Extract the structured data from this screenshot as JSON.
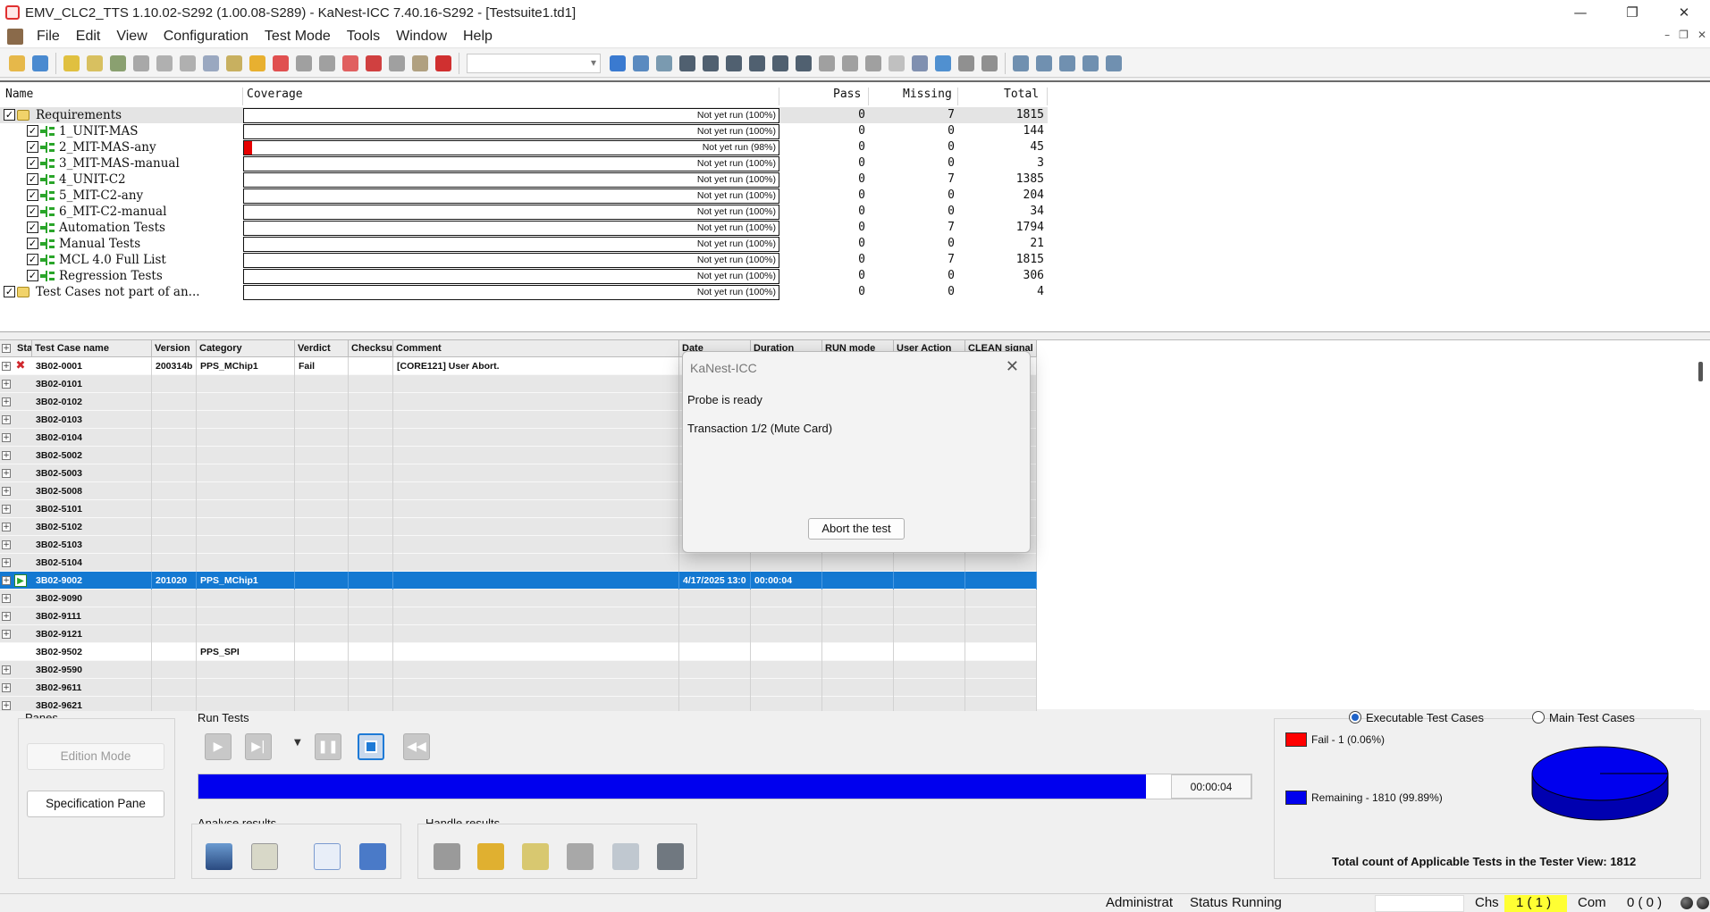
{
  "window": {
    "title": "EMV_CLC2_TTS 1.10.02-S292 (1.00.08-S289)  -  KaNest-ICC 7.40.16-S292  -  [Testsuite1.td1]",
    "minimize": "—",
    "maximize": "❐",
    "close": "✕"
  },
  "menu": {
    "items": [
      "File",
      "Edit",
      "View",
      "Configuration",
      "Test Mode",
      "Tools",
      "Window",
      "Help"
    ],
    "mdi_min": "–",
    "mdi_restore": "❐",
    "mdi_close": "✕"
  },
  "requirements": {
    "headers": {
      "name": "Name",
      "coverage": "Coverage",
      "pass": "Pass",
      "missing": "Missing",
      "total": "Total"
    },
    "rows": [
      {
        "name": "Requirements",
        "level": 0,
        "icon": "folder-icon",
        "coverage": "Not yet run (100%)",
        "fail_frac": 0,
        "pass": "0",
        "missing": "7",
        "total": "1815",
        "selected": true
      },
      {
        "name": "1_UNIT-MAS",
        "level": 1,
        "icon": "requirement-node-icon",
        "coverage": "Not yet run (100%)",
        "fail_frac": 0,
        "pass": "0",
        "missing": "0",
        "total": "144"
      },
      {
        "name": "2_MIT-MAS-any",
        "level": 1,
        "icon": "requirement-node-icon",
        "coverage": "Not yet run (98%)",
        "fail_frac": 0.015,
        "pass": "0",
        "missing": "0",
        "total": "45"
      },
      {
        "name": "3_MIT-MAS-manual",
        "level": 1,
        "icon": "requirement-node-icon",
        "coverage": "Not yet run (100%)",
        "fail_frac": 0,
        "pass": "0",
        "missing": "0",
        "total": "3"
      },
      {
        "name": "4_UNIT-C2",
        "level": 1,
        "icon": "requirement-node-icon",
        "coverage": "Not yet run (100%)",
        "fail_frac": 0,
        "pass": "0",
        "missing": "7",
        "total": "1385"
      },
      {
        "name": "5_MIT-C2-any",
        "level": 1,
        "icon": "requirement-node-icon",
        "coverage": "Not yet run (100%)",
        "fail_frac": 0,
        "pass": "0",
        "missing": "0",
        "total": "204"
      },
      {
        "name": "6_MIT-C2-manual",
        "level": 1,
        "icon": "requirement-node-icon",
        "coverage": "Not yet run (100%)",
        "fail_frac": 0,
        "pass": "0",
        "missing": "0",
        "total": "34"
      },
      {
        "name": "Automation Tests",
        "level": 1,
        "icon": "requirement-node-icon",
        "coverage": "Not yet run (100%)",
        "fail_frac": 0,
        "pass": "0",
        "missing": "7",
        "total": "1794"
      },
      {
        "name": "Manual Tests",
        "level": 1,
        "icon": "requirement-node-icon",
        "coverage": "Not yet run (100%)",
        "fail_frac": 0,
        "pass": "0",
        "missing": "0",
        "total": "21"
      },
      {
        "name": "MCL 4.0 Full List",
        "level": 1,
        "icon": "requirement-node-icon",
        "coverage": "Not yet run (100%)",
        "fail_frac": 0,
        "pass": "0",
        "missing": "7",
        "total": "1815"
      },
      {
        "name": "Regression Tests",
        "level": 1,
        "icon": "requirement-node-icon",
        "coverage": "Not yet run (100%)",
        "fail_frac": 0,
        "pass": "0",
        "missing": "0",
        "total": "306"
      },
      {
        "name": "Test Cases not part of an...",
        "level": 0,
        "icon": "folder-icon",
        "coverage": "Not yet run (100%)",
        "fail_frac": 0,
        "pass": "0",
        "missing": "0",
        "total": "4"
      }
    ]
  },
  "grid": {
    "headers": [
      "Sta",
      "Test Case name",
      "Version",
      "Category",
      "Verdict",
      "Checksu",
      "Comment",
      "Date",
      "Duration",
      "RUN mode",
      "User Action",
      "CLEAN signal"
    ],
    "rows": [
      {
        "status": "fail",
        "name": "3B02-0001",
        "version": "200314b",
        "category": "PPS_MChip1",
        "verdict": "Fail",
        "checksum": "",
        "comment": "[CORE121] User Abort.",
        "date": "",
        "duration": "",
        "style": "white"
      },
      {
        "status": "",
        "name": "3B02-0101",
        "version": "",
        "category": "",
        "verdict": "",
        "checksum": "",
        "comment": "",
        "date": "",
        "duration": "",
        "style": "gray"
      },
      {
        "status": "",
        "name": "3B02-0102",
        "version": "",
        "category": "",
        "verdict": "",
        "checksum": "",
        "comment": "",
        "date": "",
        "duration": "",
        "style": "gray"
      },
      {
        "status": "",
        "name": "3B02-0103",
        "version": "",
        "category": "",
        "verdict": "",
        "checksum": "",
        "comment": "",
        "date": "",
        "duration": "",
        "style": "gray"
      },
      {
        "status": "",
        "name": "3B02-0104",
        "version": "",
        "category": "",
        "verdict": "",
        "checksum": "",
        "comment": "",
        "date": "",
        "duration": "",
        "style": "gray"
      },
      {
        "status": "",
        "name": "3B02-5002",
        "version": "",
        "category": "",
        "verdict": "",
        "checksum": "",
        "comment": "",
        "date": "",
        "duration": "",
        "style": "gray"
      },
      {
        "status": "",
        "name": "3B02-5003",
        "version": "",
        "category": "",
        "verdict": "",
        "checksum": "",
        "comment": "",
        "date": "",
        "duration": "",
        "style": "gray"
      },
      {
        "status": "",
        "name": "3B02-5008",
        "version": "",
        "category": "",
        "verdict": "",
        "checksum": "",
        "comment": "",
        "date": "",
        "duration": "",
        "style": "gray"
      },
      {
        "status": "",
        "name": "3B02-5101",
        "version": "",
        "category": "",
        "verdict": "",
        "checksum": "",
        "comment": "",
        "date": "",
        "duration": "",
        "style": "gray"
      },
      {
        "status": "",
        "name": "3B02-5102",
        "version": "",
        "category": "",
        "verdict": "",
        "checksum": "",
        "comment": "",
        "date": "",
        "duration": "",
        "style": "gray"
      },
      {
        "status": "",
        "name": "3B02-5103",
        "version": "",
        "category": "",
        "verdict": "",
        "checksum": "",
        "comment": "",
        "date": "",
        "duration": "",
        "style": "gray"
      },
      {
        "status": "",
        "name": "3B02-5104",
        "version": "",
        "category": "",
        "verdict": "",
        "checksum": "",
        "comment": "",
        "date": "",
        "duration": "",
        "style": "gray"
      },
      {
        "status": "running",
        "name": "3B02-9002",
        "version": "201020",
        "category": "PPS_MChip1",
        "verdict": "",
        "checksum": "",
        "comment": "",
        "date": "4/17/2025 13:0",
        "duration": "00:00:04",
        "style": "selected"
      },
      {
        "status": "",
        "name": "3B02-9090",
        "version": "",
        "category": "",
        "verdict": "",
        "checksum": "",
        "comment": "",
        "date": "",
        "duration": "",
        "style": "gray"
      },
      {
        "status": "",
        "name": "3B02-9111",
        "version": "",
        "category": "",
        "verdict": "",
        "checksum": "",
        "comment": "",
        "date": "",
        "duration": "",
        "style": "gray"
      },
      {
        "status": "",
        "name": "3B02-9121",
        "version": "",
        "category": "",
        "verdict": "",
        "checksum": "",
        "comment": "",
        "date": "",
        "duration": "",
        "style": "gray"
      },
      {
        "status": "",
        "name": "3B02-9502",
        "version": "",
        "category": "PPS_SPI",
        "verdict": "",
        "checksum": "",
        "comment": "",
        "date": "",
        "duration": "",
        "style": "white",
        "no_expander": true
      },
      {
        "status": "",
        "name": "3B02-9590",
        "version": "",
        "category": "",
        "verdict": "",
        "checksum": "",
        "comment": "",
        "date": "",
        "duration": "",
        "style": "gray"
      },
      {
        "status": "",
        "name": "3B02-9611",
        "version": "",
        "category": "",
        "verdict": "",
        "checksum": "",
        "comment": "",
        "date": "",
        "duration": "",
        "style": "gray"
      },
      {
        "status": "",
        "name": "3B02-9621",
        "version": "",
        "category": "",
        "verdict": "",
        "checksum": "",
        "comment": "",
        "date": "",
        "duration": "",
        "style": "gray"
      }
    ]
  },
  "dialog": {
    "title": "KaNest-ICC",
    "close": "✕",
    "line1": "Probe is ready",
    "line2": "Transaction 1/2 (Mute Card)",
    "button": "Abort the test"
  },
  "panes": {
    "label": "Panes",
    "edition_mode": "Edition Mode",
    "specification_pane": "Specification Pane"
  },
  "run_tests": {
    "label": "Run Tests",
    "progress": 0.9,
    "elapsed": "00:00:04"
  },
  "analyse": {
    "label": "Analyse results"
  },
  "handle": {
    "label": "Handle results"
  },
  "stats": {
    "executable": "Executable Test Cases",
    "main": "Main Test Cases",
    "fail_label": "Fail - 1 (0.06%)",
    "remaining_label": "Remaining - 1810 (99.89%)",
    "fail_color": "#ff0000",
    "remaining_color": "#0000ee",
    "fail_fraction": 0.0006,
    "total": "Total count of Applicable Tests in the Tester View: 1812"
  },
  "statusbar": {
    "admin": "Administrat",
    "status_label": "Status",
    "status_value": "Running",
    "chs_label": "Chs",
    "chs_value": "1 ( 1 )",
    "com_label": "Com",
    "com_value": "0 ( 0 )"
  }
}
